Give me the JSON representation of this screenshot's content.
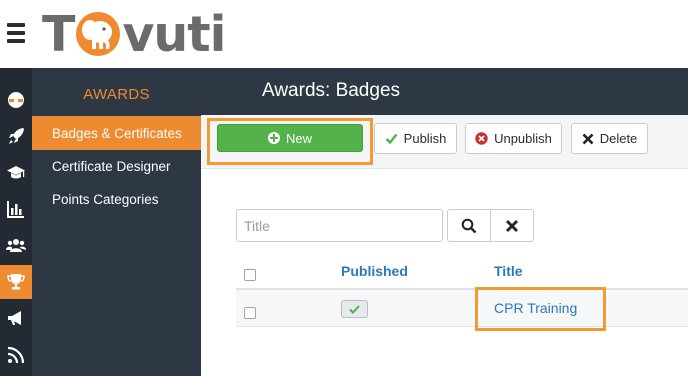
{
  "app": {
    "logo_text_start": "T",
    "logo_text_end": "vuti",
    "logo_name": "Tovuti"
  },
  "rail": {
    "items": [
      {
        "icon": "dashboard-icon",
        "active": false
      },
      {
        "icon": "rocket-icon",
        "active": false
      },
      {
        "icon": "graduation-cap-icon",
        "active": false
      },
      {
        "icon": "bar-chart-icon",
        "active": false
      },
      {
        "icon": "users-icon",
        "active": false
      },
      {
        "icon": "trophy-icon",
        "active": true
      },
      {
        "icon": "megaphone-icon",
        "active": false
      },
      {
        "icon": "feed-icon",
        "active": false
      }
    ]
  },
  "subnav": {
    "title": "AWARDS",
    "items": [
      {
        "label": "Badges & Certificates",
        "active": true
      },
      {
        "label": "Certificate Designer",
        "active": false
      },
      {
        "label": "Points Categories",
        "active": false
      }
    ]
  },
  "page": {
    "title": "Awards: Badges"
  },
  "toolbar": {
    "new_label": "New",
    "publish_label": "Publish",
    "unpublish_label": "Unpublish",
    "delete_label": "Delete"
  },
  "filter": {
    "placeholder": "Title",
    "value": ""
  },
  "table": {
    "columns": [
      "Published",
      "Title"
    ],
    "rows": [
      {
        "published": true,
        "title": "CPR Training"
      }
    ]
  },
  "colors": {
    "accent": "#ee8a2f",
    "sidebar": "#2e3844",
    "rail": "#232a33",
    "new_button": "#54b24a",
    "link": "#2a7ab8",
    "highlight": "#f39a33"
  }
}
